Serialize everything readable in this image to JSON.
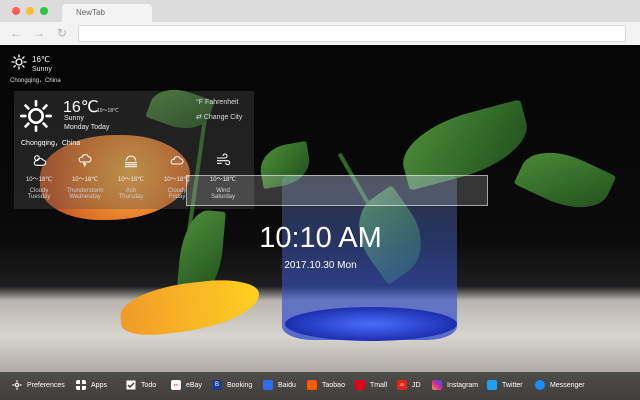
{
  "browser": {
    "tab_title": "NewTab",
    "back_glyph": "←",
    "forward_glyph": "→",
    "reload_glyph": "↻"
  },
  "weather_small": {
    "icon": "sun-icon",
    "temp": "16℃",
    "desc": "Sunny",
    "city": "Chongqing，China"
  },
  "weather_panel": {
    "icon": "sun-icon",
    "temp": "16℃",
    "range": "10～18℃",
    "desc": "Sunny",
    "day": "Monday Today",
    "city": "Chongqing，China",
    "fahrenheit_icon": "°F",
    "fahrenheit_label": "Fahrenheit",
    "change_city_icon": "⇄",
    "change_city_label": "Change City",
    "forecast": [
      {
        "icon": "cloudy-sun-icon",
        "range": "10～18℃",
        "name": "Cloudy",
        "day": "Tuesday"
      },
      {
        "icon": "thunderstorm-icon",
        "range": "10～18℃",
        "name": "Thunderstorm",
        "day": "Wednesday"
      },
      {
        "icon": "ash-icon",
        "range": "10～18℃",
        "name": "Ash",
        "day": "Thursday"
      },
      {
        "icon": "cloud-icon",
        "range": "10～18℃",
        "name": "Cloudy",
        "day": "Friday"
      },
      {
        "icon": "wind-icon",
        "range": "10～18℃",
        "name": "Wind",
        "day": "Saturday"
      }
    ]
  },
  "search": {
    "placeholder": ""
  },
  "clock": {
    "time": "10:10 AM",
    "date": "2017.10.30 Mon"
  },
  "bottom_bar": {
    "items": [
      {
        "label": "Preferences",
        "icon": "gear-icon",
        "color": "#ffffff"
      },
      {
        "label": "Apps",
        "icon": "grid-icon",
        "color": "#ffffff"
      },
      {
        "label": "Todo",
        "icon": "checkbox-icon",
        "color": "#ffffff"
      },
      {
        "label": "eBay",
        "icon": "ebay-icon",
        "color": "#ffffff"
      },
      {
        "label": "Booking",
        "icon": "booking-icon",
        "color": "#1d3e8a"
      },
      {
        "label": "Baidu",
        "icon": "baidu-icon",
        "color": "#2e6ef0"
      },
      {
        "label": "Taobao",
        "icon": "taobao-icon",
        "color": "#ff5a00"
      },
      {
        "label": "Tmall",
        "icon": "tmall-icon",
        "color": "#e2001a"
      },
      {
        "label": "JD",
        "icon": "jd-icon",
        "color": "#e1251b"
      },
      {
        "label": "Instagram",
        "icon": "instagram-icon",
        "color": "#d6249f"
      },
      {
        "label": "Twitter",
        "icon": "twitter-icon",
        "color": "#1da1f2"
      },
      {
        "label": "Messenger",
        "icon": "messenger-icon",
        "color": "#1e8cff"
      }
    ]
  }
}
